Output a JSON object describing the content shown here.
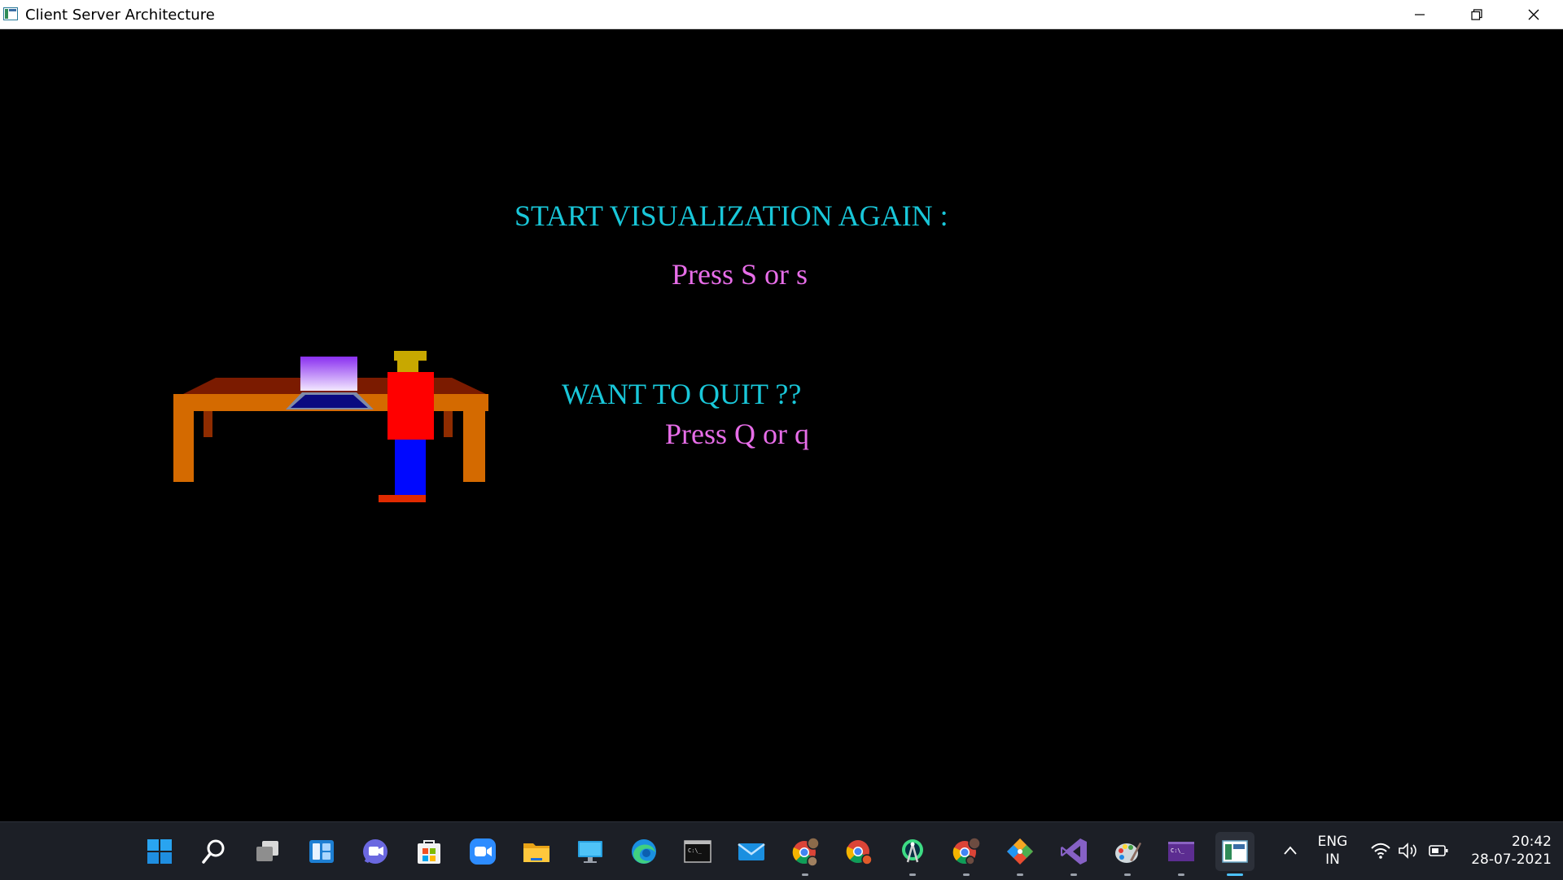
{
  "window": {
    "title": "Client Server Architecture"
  },
  "canvas": {
    "restart_heading": "START VISUALIZATION AGAIN :",
    "restart_instruction": "Press S or s",
    "quit_heading": "WANT TO QUIT ??",
    "quit_instruction": "Press Q or q",
    "colors": {
      "heading": "#19c7d9",
      "instruction": "#e76de8",
      "background": "#000000"
    }
  },
  "taskbar": {
    "apps": [
      {
        "name": "start-icon"
      },
      {
        "name": "search-icon"
      },
      {
        "name": "task-view-icon"
      },
      {
        "name": "widgets-icon"
      },
      {
        "name": "teams-chat-icon"
      },
      {
        "name": "microsoft-store-icon"
      },
      {
        "name": "zoom-icon"
      },
      {
        "name": "file-explorer-icon"
      },
      {
        "name": "remote-desktop-icon"
      },
      {
        "name": "edge-icon"
      },
      {
        "name": "terminal-icon"
      },
      {
        "name": "mail-icon"
      },
      {
        "name": "chrome-profile-1-icon"
      },
      {
        "name": "chrome-profile-2-icon"
      },
      {
        "name": "android-studio-icon"
      },
      {
        "name": "chrome-profile-3-icon"
      },
      {
        "name": "git-icon"
      },
      {
        "name": "visual-studio-icon"
      },
      {
        "name": "paint-icon"
      },
      {
        "name": "command-prompt-icon"
      },
      {
        "name": "client-server-app-icon"
      }
    ],
    "tray": {
      "language_line1": "ENG",
      "language_line2": "IN",
      "time": "20:42",
      "date": "28-07-2021"
    }
  }
}
